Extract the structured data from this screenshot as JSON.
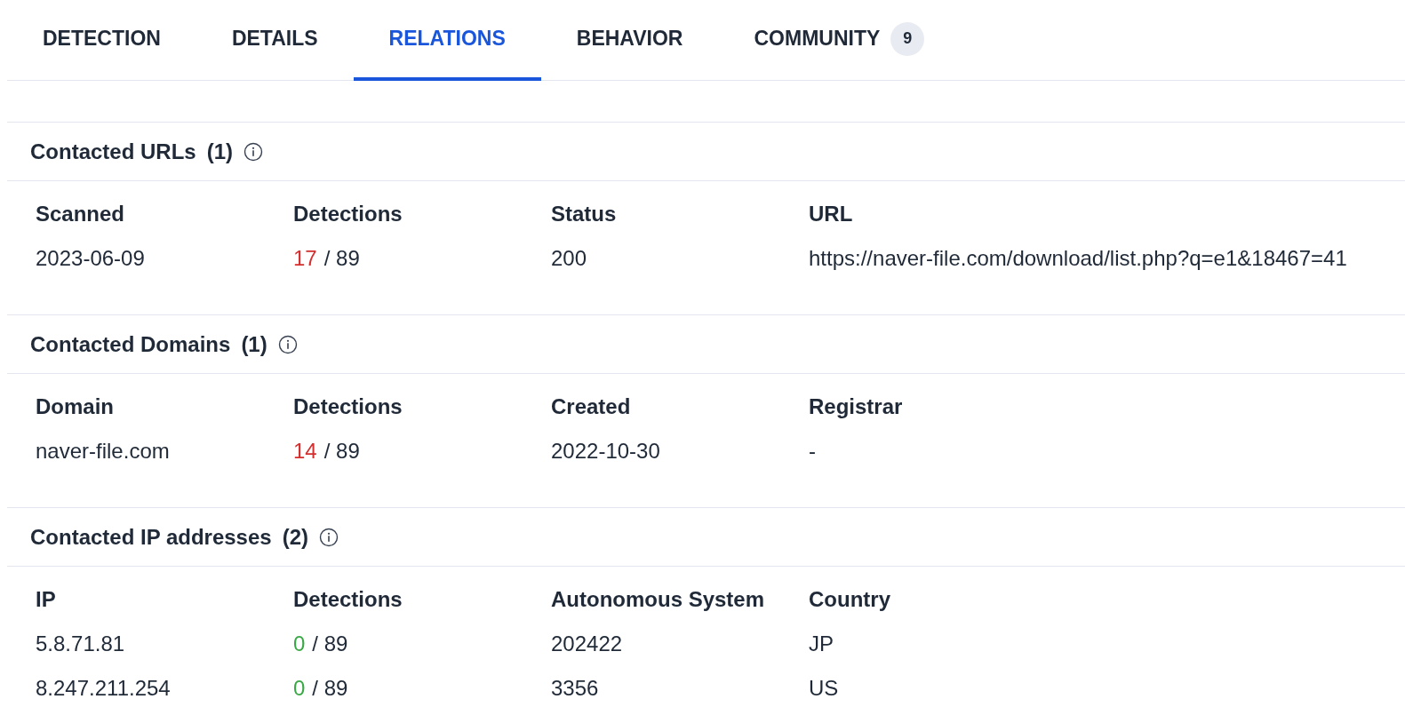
{
  "tabs": [
    {
      "label": "DETECTION",
      "selected": false
    },
    {
      "label": "DETAILS",
      "selected": false
    },
    {
      "label": "RELATIONS",
      "selected": true
    },
    {
      "label": "BEHAVIOR",
      "selected": false
    },
    {
      "label": "COMMUNITY",
      "selected": false,
      "badge": "9"
    }
  ],
  "sections": [
    {
      "title": "Contacted URLs",
      "count": "(1)",
      "columns": [
        "Scanned",
        "Detections",
        "Status",
        "URL"
      ],
      "rows": [
        {
          "cells": [
            "2023-06-09",
            {
              "positives": "17",
              "total": "/ 89",
              "flagged": true
            },
            "200",
            "https://naver-file.com/download/list.php?q=e1&18467=41"
          ]
        }
      ]
    },
    {
      "title": "Contacted Domains",
      "count": "(1)",
      "columns": [
        "Domain",
        "Detections",
        "Created",
        "Registrar"
      ],
      "rows": [
        {
          "cells": [
            "naver-file.com",
            {
              "positives": "14",
              "total": "/ 89",
              "flagged": true
            },
            "2022-10-30",
            "-"
          ]
        }
      ]
    },
    {
      "title": "Contacted IP addresses",
      "count": "(2)",
      "columns": [
        "IP",
        "Detections",
        "Autonomous System",
        "Country"
      ],
      "rows": [
        {
          "cells": [
            "5.8.71.81",
            {
              "positives": "0",
              "total": "/ 89",
              "flagged": false
            },
            "202422",
            "JP"
          ]
        },
        {
          "cells": [
            "8.247.211.254",
            {
              "positives": "0",
              "total": "/ 89",
              "flagged": false
            },
            "3356",
            "US"
          ]
        }
      ]
    }
  ]
}
